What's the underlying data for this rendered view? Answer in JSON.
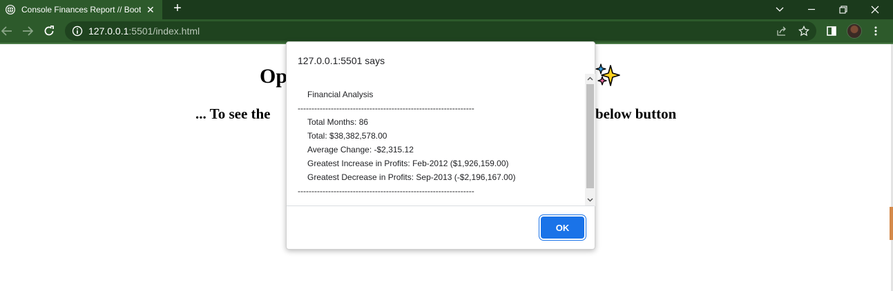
{
  "browser": {
    "tab": {
      "title": "Console Finances Report // Boot",
      "close_glyph": "✕"
    },
    "new_tab_glyph": "+",
    "address": {
      "host": "127.0.0.1",
      "rest": ":5501/index.html"
    },
    "icons": {
      "favicon": "globe-icon",
      "back": "back-arrow-icon",
      "forward": "forward-arrow-icon",
      "reload": "reload-icon",
      "site_info": "info-icon",
      "share": "share-icon",
      "bookmark": "star-icon",
      "side_panel": "side-panel-icon",
      "profile": "avatar",
      "menu": "kebab-menu-icon",
      "window": [
        "chevron-down-icon",
        "minimize-icon",
        "restore-icon",
        "close-icon"
      ]
    },
    "colors": {
      "tabstrip": "#1b3a1c",
      "toolbar": "#2d5a2b",
      "omnibox": "#1f431f"
    }
  },
  "page": {
    "heading_visible_left": "Op",
    "subheading_left": "... To see the ",
    "subheading_right": "below button",
    "sparkle_icon": "sparkles-icon"
  },
  "dialog": {
    "origin": "127.0.0.1:5501 says",
    "message": {
      "title": "Financial Analysis",
      "divider": "----------------------------------------------------------------",
      "lines": [
        "Total Months: 86",
        "Total: $38,382,578.00",
        "Average Change: -$2,315.12",
        "Greatest Increase in Profits: Feb-2012 ($1,926,159.00)",
        "Greatest Decrease in Profits: Sep-2013 (-$2,196,167.00)"
      ]
    },
    "ok_label": "OK",
    "accent": "#1a73e8"
  }
}
